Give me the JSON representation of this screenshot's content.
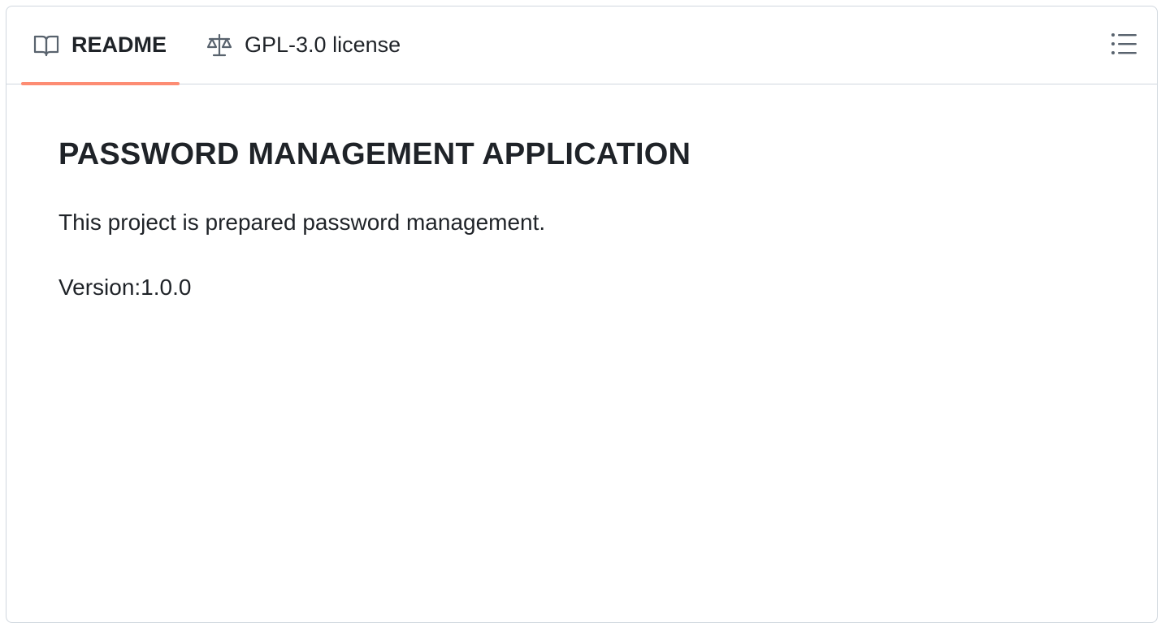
{
  "tabs": [
    {
      "label": "README",
      "icon": "book-icon",
      "active": true
    },
    {
      "label": "GPL-3.0 license",
      "icon": "scale-icon",
      "active": false
    }
  ],
  "toolbar": {
    "outline_icon": "list-icon"
  },
  "readme": {
    "title": "PASSWORD MANAGEMENT APPLICATION",
    "paragraphs": [
      "This project is prepared password management.",
      "Version:1.0.0"
    ]
  },
  "colors": {
    "accent": "#fd8c73",
    "border": "#d0d7de",
    "text": "#1f2328",
    "icon": "#59636e"
  }
}
